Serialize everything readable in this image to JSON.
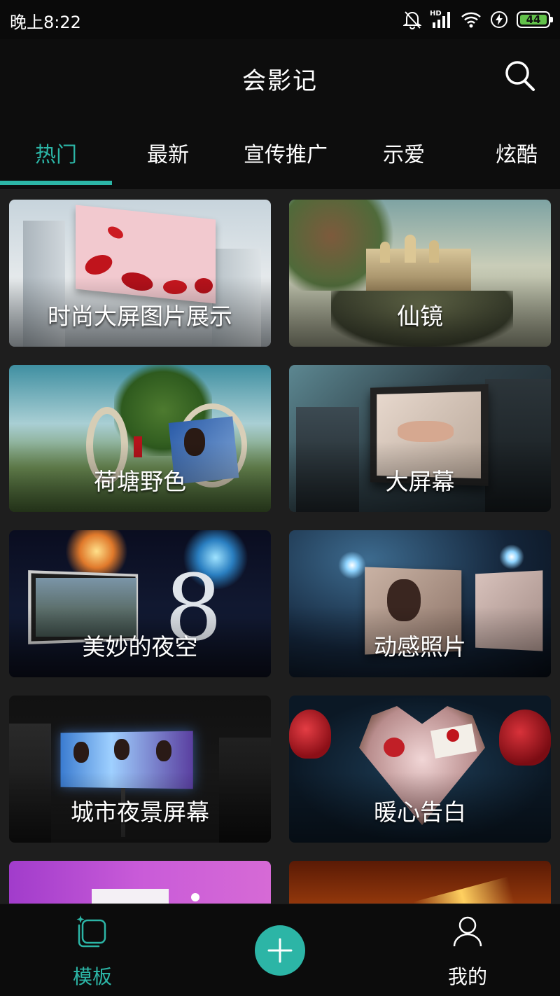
{
  "status_bar": {
    "time": "晚上8:22",
    "network_label": "HD",
    "battery": "44",
    "icons": [
      "mute-icon",
      "signal-icon",
      "wifi-icon",
      "charging-icon",
      "battery-icon"
    ]
  },
  "header": {
    "title": "会影记",
    "search_icon": "search-icon"
  },
  "tabs": [
    {
      "label": "热门",
      "active": true
    },
    {
      "label": "最新",
      "active": false
    },
    {
      "label": "宣传推广",
      "active": false
    },
    {
      "label": "示爱",
      "active": false
    },
    {
      "label": "炫酷",
      "active": false
    }
  ],
  "templates": [
    {
      "title": "时尚大屏图片展示"
    },
    {
      "title": "仙镜"
    },
    {
      "title": "荷塘野色"
    },
    {
      "title": "大屏幕"
    },
    {
      "title": "美妙的夜空"
    },
    {
      "title": "动感照片"
    },
    {
      "title": "城市夜景屏幕"
    },
    {
      "title": "暖心告白"
    }
  ],
  "bottom_nav": {
    "templates_label": "模板",
    "add_icon": "plus-icon",
    "mine_label": "我的"
  },
  "colors": {
    "accent": "#2cb5a6",
    "background": "#0d0d0d",
    "grid_background": "#1e1e1e"
  }
}
